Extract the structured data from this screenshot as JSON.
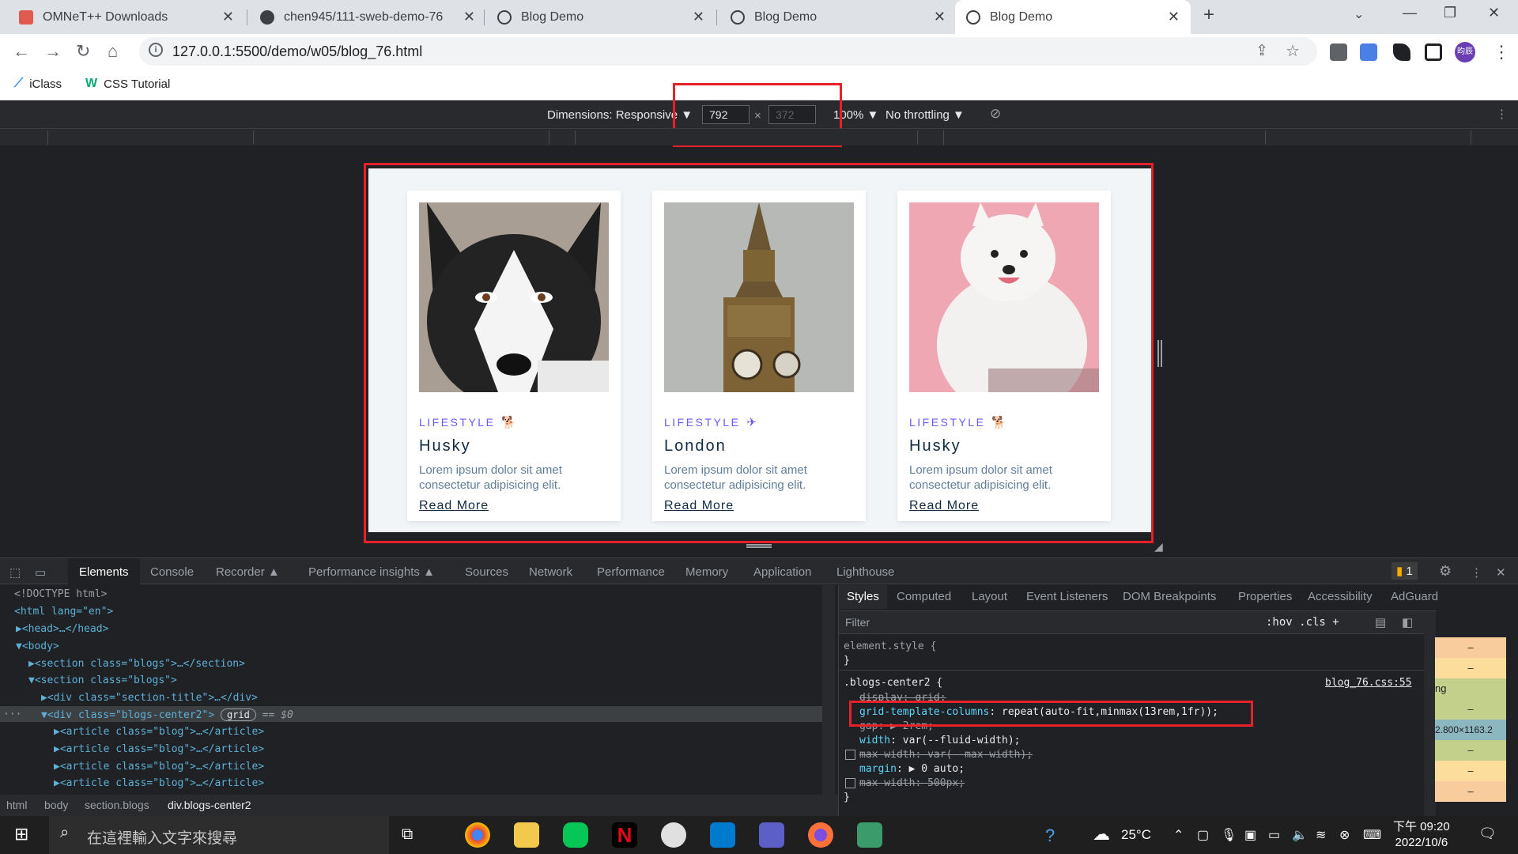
{
  "browser": {
    "tabs": [
      {
        "title": "OMNeT++ Downloads",
        "icon_color": "#e05a4f"
      },
      {
        "title": "chen945/111-sweb-demo-76",
        "icon_color": "#3c4043"
      },
      {
        "title": "Blog Demo",
        "icon_color": "#3c4043"
      },
      {
        "title": "Blog Demo",
        "icon_color": "#3c4043"
      },
      {
        "title": "Blog Demo",
        "icon_color": "#3c4043",
        "active": true
      }
    ],
    "new_tab": "+",
    "url": "127.0.0.1:5500/demo/w05/blog_76.html",
    "bookmarks": [
      {
        "label": "iClass",
        "icon": "iclass-icon"
      },
      {
        "label": "CSS Tutorial",
        "icon": "w3schools-icon"
      }
    ],
    "profile_initials": "昀辰"
  },
  "device_toolbar": {
    "dimensions_label": "Dimensions: Responsive ▼",
    "width": "792",
    "height": "372",
    "times": "×",
    "zoom": "100% ▼",
    "throttling": "No throttling ▼"
  },
  "blog": {
    "cards": [
      {
        "category": "LIFESTYLE",
        "title": "Husky",
        "text": "Lorem ipsum dolor sit amet consectetur adipisicing elit.",
        "link": "Read More",
        "image": "husky-photo"
      },
      {
        "category": "LIFESTYLE",
        "title": "London",
        "text": "Lorem ipsum dolor sit amet consectetur adipisicing elit.",
        "link": "Read More",
        "image": "big-ben-photo"
      },
      {
        "category": "LIFESTYLE",
        "title": "Husky",
        "text": "Lorem ipsum dolor sit amet consectetur adipisicing elit.",
        "link": "Read More",
        "image": "samoyed-photo"
      }
    ]
  },
  "devtools": {
    "tabs": [
      "Elements",
      "Console",
      "Recorder ▲",
      "Performance insights ▲",
      "Sources",
      "Network",
      "Performance",
      "Memory",
      "Application",
      "Lighthouse"
    ],
    "issues_badge": "1",
    "dom": [
      "<!DOCTYPE html>",
      "<html lang=\"en\">",
      "▶<head>…</head>",
      "▼<body>",
      "▶<section class=\"blogs\">…</section>",
      "▼<section class=\"blogs\">",
      "▶<div class=\"section-title\">…</div>",
      "▼<div class=\"blogs-center2\">",
      "▶<article class=\"blog\">…</article>",
      "▶<article class=\"blog\">…</article>",
      "▶<article class=\"blog\">…</article>",
      "▶<article class=\"blog\">…</article>"
    ],
    "selected_badge": "grid",
    "selected_suffix": "== $0",
    "breadcrumbs": [
      "html",
      "body",
      "section.blogs",
      "div.blogs-center2"
    ],
    "styles_tabs": [
      "Styles",
      "Computed",
      "Layout",
      "Event Listeners",
      "DOM Breakpoints",
      "Properties",
      "Accessibility",
      "AdGuard"
    ],
    "filter_placeholder": "Filter",
    "filter_tools": ":hov  .cls  +",
    "element_style": "element.style {",
    "close_brace": "}",
    "rule_selector": ".blogs-center2 {",
    "rule_source": "blog_76.css:55",
    "rule_lines": [
      {
        "prop": "display",
        "value": "grid;",
        "struck": true
      },
      {
        "prop": "grid-template-columns",
        "value": "repeat(auto-fit,minmax(13rem,1fr));",
        "struck": false
      },
      {
        "prop": "gap",
        "value": "▶ 2rem;",
        "struck": true
      },
      {
        "prop": "width",
        "value": "var(--fluid-width);",
        "struck": false
      },
      {
        "prop": "max-width",
        "value": "var(--max-width);",
        "struck": true
      },
      {
        "prop": "margin",
        "value": "▶ 0 auto;",
        "struck": false
      },
      {
        "prop": "max-width",
        "value": "500px;",
        "struck": true
      }
    ],
    "box_model": [
      "–",
      "–",
      "ng",
      "–",
      "2.800×1163.2",
      "–",
      "–",
      "–"
    ]
  },
  "taskbar": {
    "search_placeholder": "在這裡輸入文字來搜尋",
    "weather": "25°C",
    "time": "下午 09:20",
    "date": "2022/10/6"
  }
}
